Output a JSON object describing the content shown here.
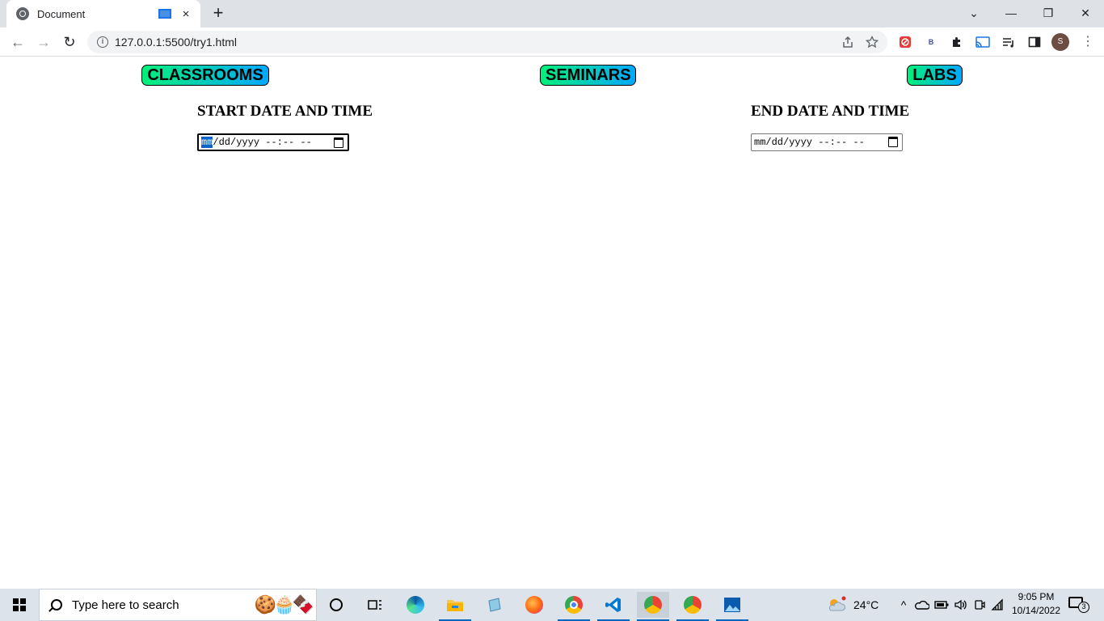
{
  "browser": {
    "tab_title": "Document",
    "tab_close_icon": "×",
    "new_tab_icon": "+",
    "url": "127.0.0.1:5500/try1.html",
    "profile_initial": "S",
    "window_controls": {
      "tab_search": "⌄",
      "minimize": "—",
      "restore": "❐",
      "close": "✕"
    },
    "nav_icons": {
      "back": "←",
      "forward": "→",
      "reload": "↻",
      "info": "i"
    }
  },
  "page": {
    "buttons": [
      {
        "label": "CLASSROOMS"
      },
      {
        "label": "SEMINARS"
      },
      {
        "label": "LABS"
      }
    ],
    "start": {
      "heading": "START DATE AND TIME",
      "mm": "mm",
      "rest": "/dd/yyyy --:-- --"
    },
    "end": {
      "heading": "END DATE AND TIME",
      "value": "mm/dd/yyyy --:-- --"
    }
  },
  "taskbar": {
    "search_placeholder": "Type here to search",
    "temperature": "24°C",
    "time": "9:05 PM",
    "date": "10/14/2022",
    "notification_count": "3",
    "accent_color": "#0067c0"
  },
  "colors": {
    "button_gradient_start": "#00f07a",
    "button_gradient_end": "#00a8ff",
    "focus_highlight": "#0a64c8"
  }
}
